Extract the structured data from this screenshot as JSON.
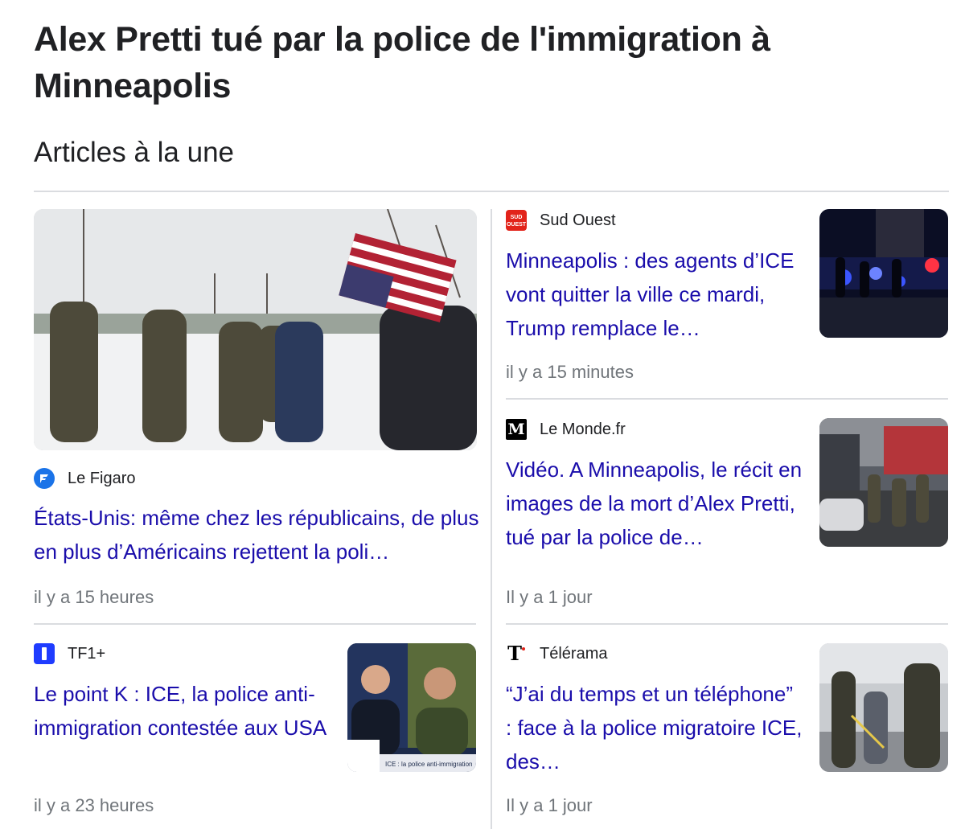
{
  "page": {
    "title": "Alex Pretti tué par la police de l'immigration à Minneapolis",
    "section_title": "Articles à la une"
  },
  "articles": [
    {
      "source": "Le Figaro",
      "logo_icon": "le-figaro-logo",
      "logo_color": "#1a73e8",
      "headline": "États-Unis: même chez les républicains, de plus en plus d’Américains rejettent la poli…",
      "time": "il y a 15 heures"
    },
    {
      "source": "Sud Ouest",
      "logo_icon": "sud-ouest-logo",
      "logo_color": "#e2231a",
      "logo_text": "SUD\nOUEST",
      "headline": "Minneapolis : des agents d’ICE vont quitter la ville ce mardi, Trump remplace le…",
      "time": "il y a 15 minutes"
    },
    {
      "source": "Le Monde.fr",
      "logo_icon": "le-monde-logo",
      "logo_color": "#000000",
      "logo_text": "M",
      "headline": "Vidéo. A Minneapolis, le récit en images de la mort d’Alex Pretti, tué par la police de…",
      "time": "Il y a 1 jour"
    },
    {
      "source": "TF1+",
      "logo_icon": "tf1-logo",
      "logo_color": "#1f3cff",
      "headline": "Le point K : ICE, la police anti-immigration contestée aux USA",
      "time": "il y a 23 heures",
      "thumb_caption": "ICE : la police anti-immigration"
    },
    {
      "source": "Télérama",
      "logo_icon": "telerama-logo",
      "logo_color": "#000000",
      "logo_text": "T",
      "headline": "“J’ai du temps et un téléphone” : face à la police migratoire ICE, des…",
      "time": "Il y a 1 jour"
    }
  ],
  "colors": {
    "headline_link": "#1a0dab",
    "meta_text": "#70757a",
    "divider": "#dadce0"
  }
}
